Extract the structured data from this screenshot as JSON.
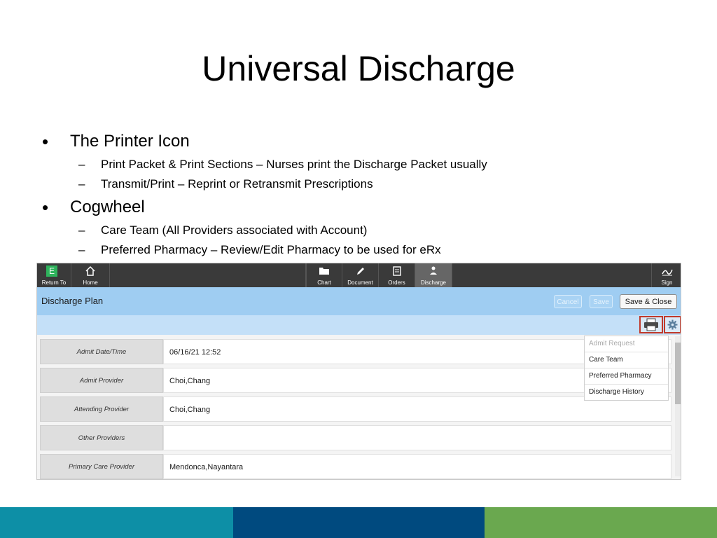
{
  "slide": {
    "title": "Universal Discharge",
    "bullets": [
      {
        "text": "The Printer Icon",
        "subs": [
          "Print Packet & Print Sections – Nurses print the Discharge Packet usually",
          "Transmit/Print – Reprint or Retransmit Prescriptions"
        ]
      },
      {
        "text": "Cogwheel",
        "subs": [
          "Care Team (All Providers associated with Account)",
          "Preferred Pharmacy – Review/Edit Pharmacy to be used for eRx"
        ]
      }
    ]
  },
  "app": {
    "toolbar": {
      "return_badge": "E",
      "return_label": "Return To",
      "home_label": "Home",
      "chart_label": "Chart",
      "document_label": "Document",
      "orders_label": "Orders",
      "discharge_label": "Discharge",
      "sign_label": "Sign"
    },
    "header": {
      "title": "Discharge Plan",
      "cancel_label": "Cancel",
      "save_label": "Save",
      "save_close_label": "Save & Close"
    },
    "fields": [
      {
        "label": "Admit Date/Time",
        "value": "06/16/21 12:52"
      },
      {
        "label": "Admit Provider",
        "value": "Choi,Chang"
      },
      {
        "label": "Attending Provider",
        "value": "Choi,Chang"
      },
      {
        "label": "Other Providers",
        "value": ""
      },
      {
        "label": "Primary Care Provider",
        "value": "Mendonca,Nayantara"
      }
    ],
    "menu": [
      {
        "label": "Admit Request",
        "disabled": true
      },
      {
        "label": "Care Team",
        "disabled": false
      },
      {
        "label": "Preferred Pharmacy",
        "disabled": false
      },
      {
        "label": "Discharge History",
        "disabled": false
      }
    ]
  },
  "colors": {
    "toolbar": "#3a3a3a",
    "header": "#9fcdf2",
    "highlight_box": "#c0392b",
    "footer_teal": "#0d8fa6",
    "footer_navy": "#004a7f",
    "footer_green": "#6aa84f"
  },
  "icons": [
    "home-icon",
    "folder-icon",
    "pencil-icon",
    "orders-icon",
    "discharge-icon",
    "sign-icon",
    "printer-icon",
    "gear-icon"
  ]
}
